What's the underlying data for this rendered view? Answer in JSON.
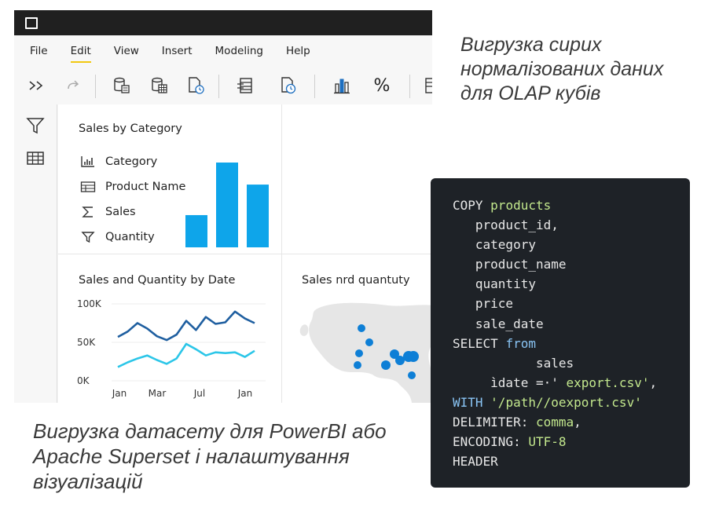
{
  "app": {
    "menu": [
      {
        "label": "File"
      },
      {
        "label": "Edit",
        "active": true
      },
      {
        "label": "View"
      },
      {
        "label": "Insert"
      },
      {
        "label": "Modeling"
      },
      {
        "label": "Help"
      }
    ],
    "toolbar": {
      "percent_label": "%"
    },
    "panels": {
      "category": {
        "title": "Sales by Category",
        "fields": [
          {
            "label": "Category",
            "icon": "bar-chart-icon"
          },
          {
            "label": "Product Name",
            "icon": "table-list-icon"
          },
          {
            "label": "Sales",
            "icon": "sigma-icon"
          },
          {
            "label": "Quantity",
            "icon": "filter-icon"
          }
        ]
      },
      "date": {
        "title": "Sales and Quantity by Date"
      },
      "map": {
        "title": "Sales nrd quantuty"
      }
    }
  },
  "chart_data": [
    {
      "type": "bar",
      "title": "Sales by Category",
      "categories": [
        "",
        "",
        ""
      ],
      "values": [
        38,
        100,
        74
      ],
      "color": "#0ea5ea"
    },
    {
      "type": "line",
      "title": "Sales and Quantity by Date",
      "x": [
        "Jan",
        "Mar",
        "Jul",
        "Jan"
      ],
      "yticks": [
        "100K",
        "50K",
        "0K"
      ],
      "ylim": [
        0,
        100000
      ],
      "series": [
        {
          "color": "#1f5fa0",
          "values": [
            57000,
            64000,
            75000,
            68000,
            58000,
            53000,
            60000,
            78000,
            66000,
            83000,
            74000,
            76000,
            90000,
            81000,
            75000
          ]
        },
        {
          "color": "#2cc6e8",
          "values": [
            18000,
            24000,
            29000,
            33000,
            27000,
            22000,
            29000,
            48000,
            41000,
            33000,
            37000,
            36000,
            37000,
            31000,
            39000
          ]
        }
      ]
    }
  ],
  "captions": {
    "right": "Вигрузка сирих нормалізованих даних для OLAP кубів",
    "bottom": "Вигрузка датасету для PowerBI або Apache Superset і налаштування візуалізацій"
  },
  "code": {
    "lines": [
      [
        {
          "t": "COPY ",
          "c": "kw"
        },
        {
          "t": "products",
          "c": "hl"
        }
      ],
      [
        {
          "t": "   product_id,",
          "c": "kw"
        }
      ],
      [
        {
          "t": "   category",
          "c": "kw"
        }
      ],
      [
        {
          "t": "   product_name",
          "c": "kw"
        }
      ],
      [
        {
          "t": "   quantity",
          "c": "kw"
        }
      ],
      [
        {
          "t": "   price",
          "c": "kw"
        }
      ],
      [
        {
          "t": "   sale_date",
          "c": "kw"
        }
      ],
      [
        {
          "t": "SELECT ",
          "c": "kw"
        },
        {
          "t": "from",
          "c": "bl"
        }
      ],
      [
        {
          "t": "           sales",
          "c": "kw"
        }
      ],
      [
        {
          "t": "     ìdate =·' ",
          "c": "kw"
        },
        {
          "t": "export.csv'",
          "c": "hl"
        },
        {
          "t": ",",
          "c": "kw"
        }
      ],
      [
        {
          "t": "WITH ",
          "c": "bl"
        },
        {
          "t": "'/path//oexport.csv'",
          "c": "hl"
        }
      ],
      [
        {
          "t": "DELIMITER: ",
          "c": "kw"
        },
        {
          "t": "comma",
          "c": "hl"
        },
        {
          "t": ",",
          "c": "kw"
        }
      ],
      [
        {
          "t": "ENCODING: ",
          "c": "kw"
        },
        {
          "t": "UTF-8",
          "c": "hl"
        }
      ],
      [
        {
          "t": "HEADER",
          "c": "kw"
        }
      ]
    ]
  }
}
